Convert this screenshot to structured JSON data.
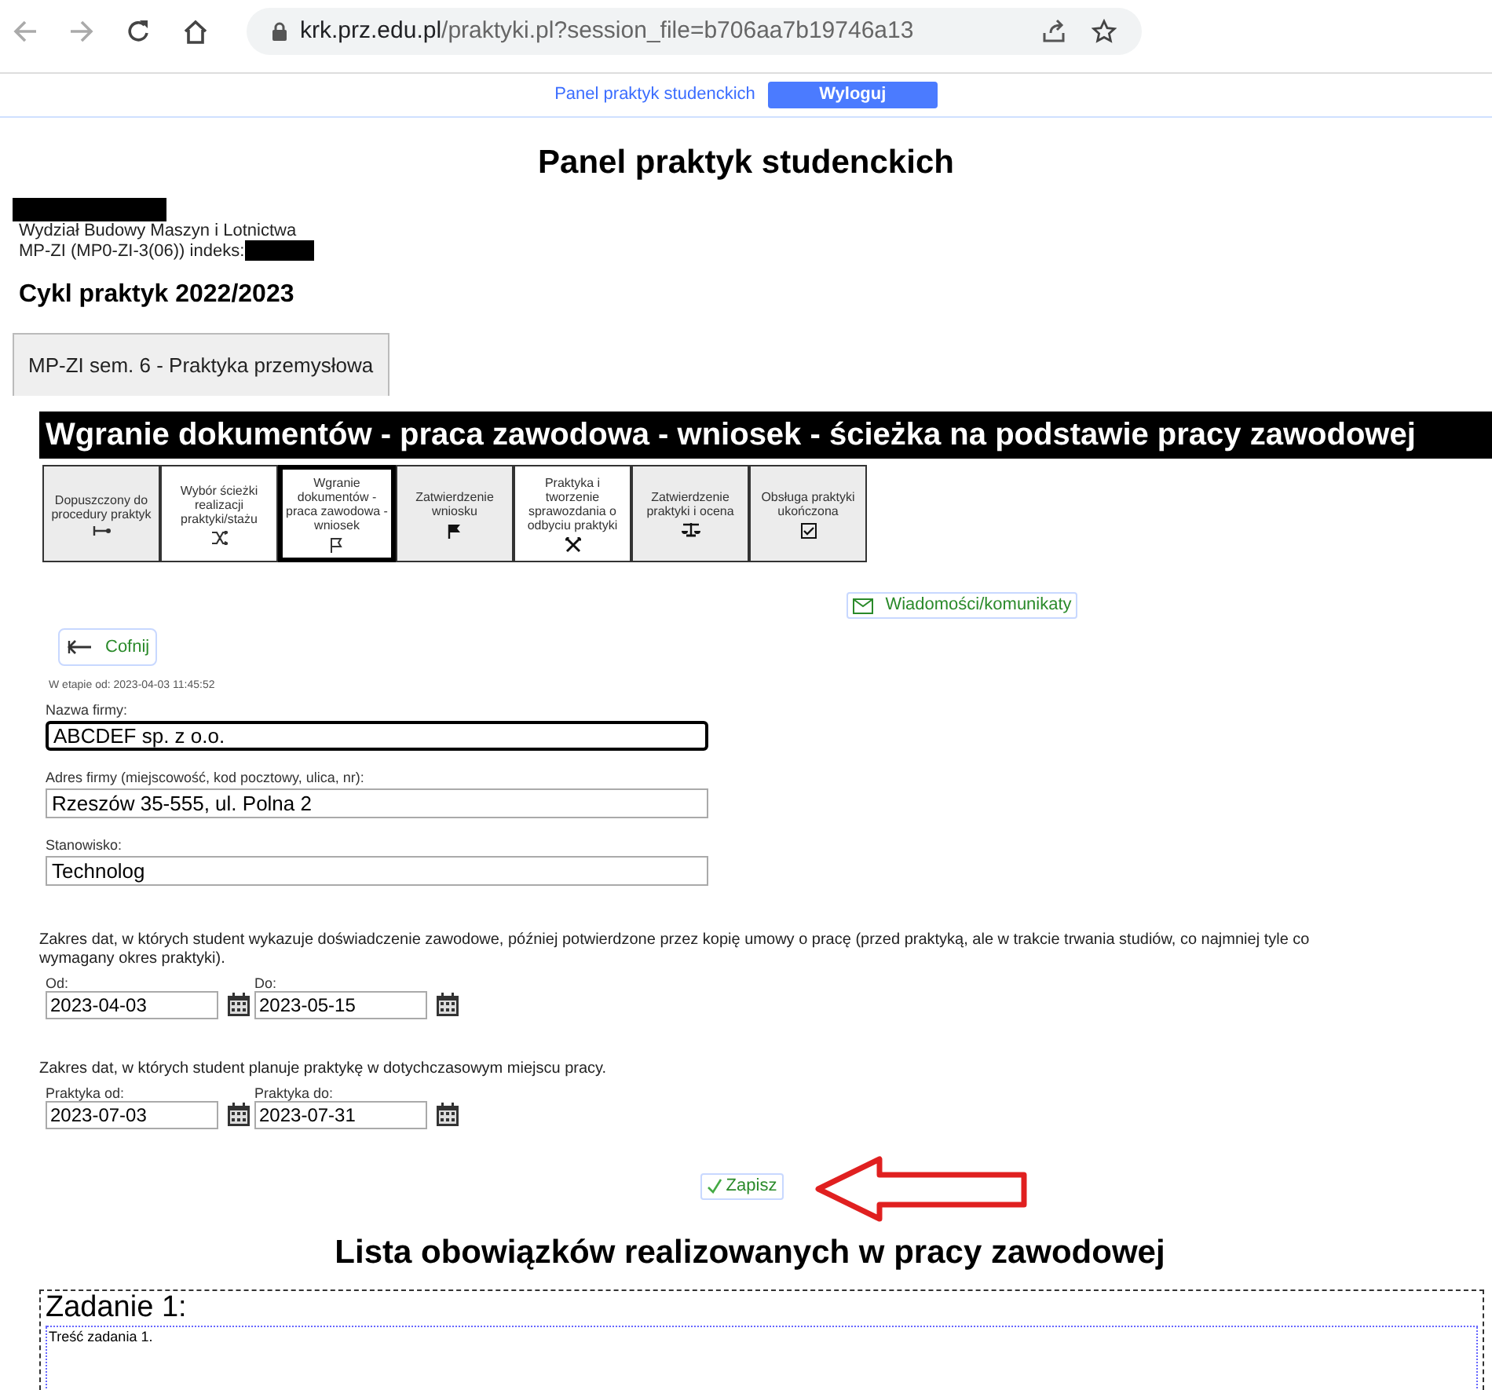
{
  "browser": {
    "url_host": "krk.prz.edu.pl",
    "url_path": "/praktyki.pl?session_file=b706aa7b19746a13"
  },
  "top_nav": {
    "link": "Panel praktyk studenckich",
    "logout": "Wyloguj"
  },
  "page_title": "Panel praktyk studenckich",
  "student": {
    "faculty": "Wydział Budowy Maszyn i Lotnictwa",
    "program": "MP-ZI (MP0-ZI-3(06)) indeks:"
  },
  "cycle_title": "Cykl praktyk 2022/2023",
  "tabs": [
    {
      "label": "MP-ZI sem. 6 - Praktyka przemysłowa",
      "selected": true
    }
  ],
  "stage_title": "Wgranie dokumentów - praca zawodowa - wniosek - ścieżka na podstawie pracy zawodowej",
  "steps": [
    {
      "label": "Dopuszczony do procedury praktyk",
      "shaded": true,
      "selected": false
    },
    {
      "label": "Wybór ścieżki realizacji praktyki/stażu",
      "shaded": false,
      "selected": false
    },
    {
      "label": "Wgranie dokumentów - praca zawodowa - wniosek",
      "shaded": false,
      "selected": true
    },
    {
      "label": "Zatwierdzenie wniosku",
      "shaded": true,
      "selected": false
    },
    {
      "label": "Praktyka i tworzenie sprawozdania o odbyciu praktyki",
      "shaded": false,
      "selected": false
    },
    {
      "label": "Zatwierdzenie praktyki i ocena",
      "shaded": true,
      "selected": false
    },
    {
      "label": "Obsługa praktyki ukończona",
      "shaded": true,
      "selected": false
    }
  ],
  "messages_button": "Wiadomości/komunikaty",
  "back_button": "Cofnij",
  "stage_since": "W etapie od: 2023-04-03 11:45:52",
  "fields": [
    {
      "label": "Nazwa firmy:",
      "value": "ABCDEF sp. z o.o.",
      "focused": true
    },
    {
      "label": "Adres firmy (miejscowość, kod pocztowy, ulica, nr):",
      "value": "Rzeszów 35-555, ul. Polna 2",
      "focused": false
    },
    {
      "label": "Stanowisko:",
      "value": "Technolog",
      "focused": false
    }
  ],
  "date_groups": [
    {
      "description": "Zakres dat, w których student wykazuje doświadczenie zawodowe, później potwierdzone przez kopię umowy o pracę (przed praktyką, ale w trakcie trwania studiów, co najmniej tyle co\nwymagany okres praktyki).",
      "dates": [
        {
          "label": "Od:",
          "value": "2023-04-03"
        },
        {
          "label": "Do:",
          "value": "2023-05-15"
        }
      ]
    },
    {
      "description": "Zakres dat, w których student planuje praktykę w dotychczasowym miejscu pracy.",
      "dates": [
        {
          "label": "Praktyka od:",
          "value": "2023-07-03"
        },
        {
          "label": "Praktyka do:",
          "value": "2023-07-31"
        }
      ]
    }
  ],
  "save_button": "Zapisz",
  "duties_title": "Lista obowiązków realizowanych w pracy zawodowej",
  "tasks": [
    {
      "title": "Zadanie 1:",
      "content": "Treść zadania 1."
    }
  ]
}
